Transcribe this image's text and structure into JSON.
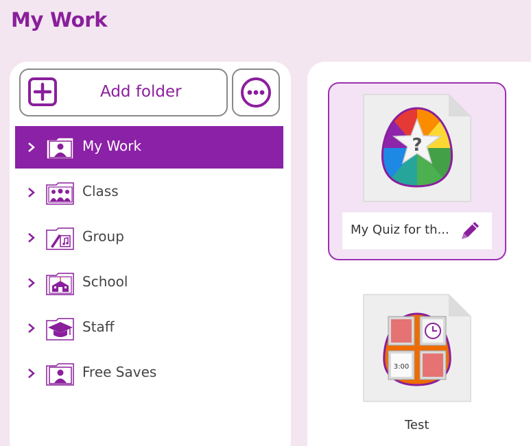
{
  "page": {
    "title": "My Work"
  },
  "toolbar": {
    "add_folder_label": "Add folder",
    "more_icon": "ellipsis-icon",
    "add_icon": "plus-square-icon"
  },
  "folders": [
    {
      "label": "My Work",
      "icon": "person-folder-icon",
      "selected": true
    },
    {
      "label": "Class",
      "icon": "class-group-folder-icon",
      "selected": false
    },
    {
      "label": "Group",
      "icon": "music-art-folder-icon",
      "selected": false
    },
    {
      "label": "School",
      "icon": "school-building-folder-icon",
      "selected": false
    },
    {
      "label": "Staff",
      "icon": "graduation-cap-folder-icon",
      "selected": false
    },
    {
      "label": "Free Saves",
      "icon": "person-folder-icon",
      "selected": false
    }
  ],
  "files": [
    {
      "name": "My Quiz for th...",
      "icon": "quiz-star-icon",
      "selected": true,
      "editable": true
    },
    {
      "name": "Test",
      "icon": "activity-cards-icon",
      "selected": false,
      "editable": false
    }
  ],
  "colors": {
    "accent": "#8b21a6",
    "background": "#f3e6f0",
    "selected_card": "#f3e3f5"
  }
}
